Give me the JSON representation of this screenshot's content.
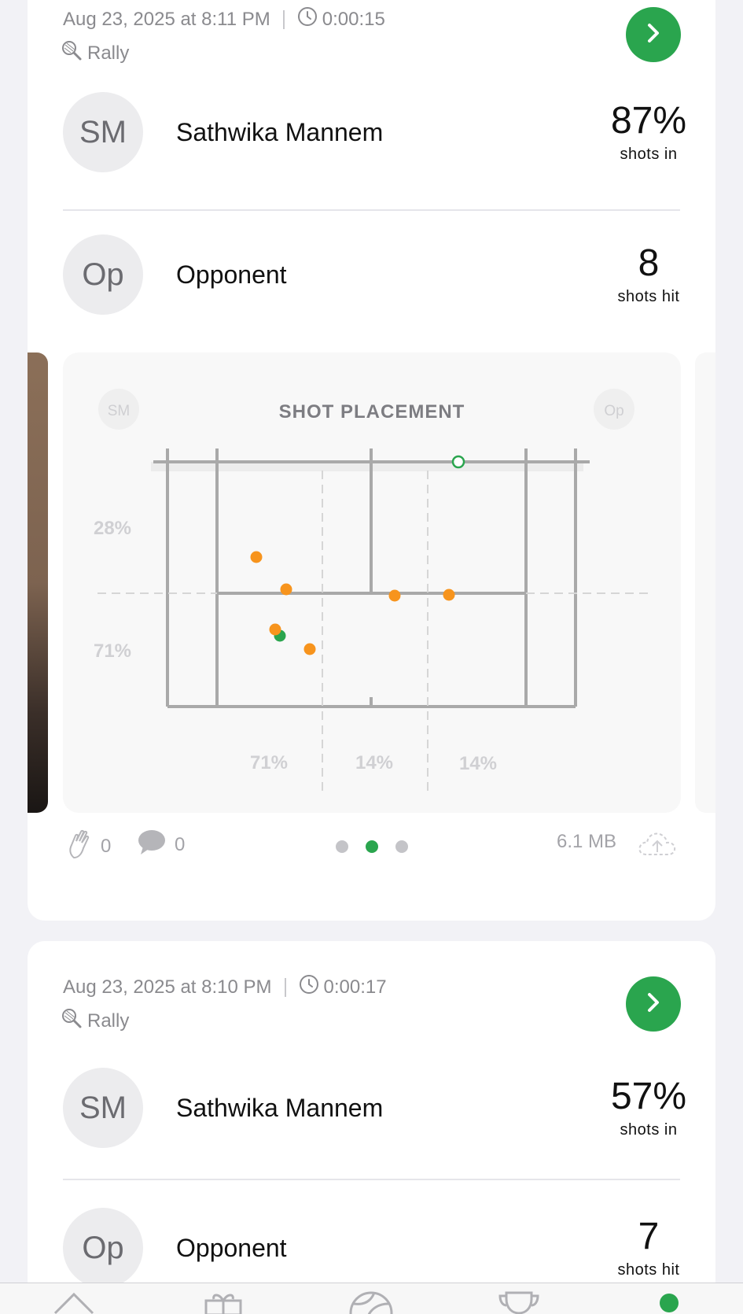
{
  "sessions": [
    {
      "date": "Aug 23, 2025 at 8:11 PM",
      "duration": "0:00:15",
      "type": "Rally",
      "player": {
        "initials": "SM",
        "name": "Sathwika Mannem",
        "stat": "87%",
        "stat_label": "shots in"
      },
      "opponent": {
        "initials": "Op",
        "name": "Opponent",
        "stat": "8",
        "stat_label": "shots hit"
      },
      "placement": {
        "title": "SHOT PLACEMENT",
        "left_badge": "SM",
        "right_badge": "Op",
        "depth_pct": [
          "28%",
          "71%"
        ],
        "lane_pct": [
          "71%",
          "14%",
          "14%"
        ]
      },
      "footer": {
        "claps": "0",
        "comments": "0",
        "size": "6.1 MB"
      }
    },
    {
      "date": "Aug 23, 2025 at 8:10 PM",
      "duration": "0:00:17",
      "type": "Rally",
      "player": {
        "initials": "SM",
        "name": "Sathwika Mannem",
        "stat": "57%",
        "stat_label": "shots in"
      },
      "opponent": {
        "initials": "Op",
        "name": "Opponent",
        "stat": "7",
        "stat_label": "shots hit"
      }
    }
  ],
  "colors": {
    "accent": "#2aa54e",
    "shot": "#f7941d",
    "court_line": "#a9a9a9"
  },
  "icons": {
    "go": "chevron-right-icon",
    "clock": "clock-icon",
    "racket": "racket-icon",
    "clap": "clap-icon",
    "comment": "comment-icon",
    "upload": "cloud-upload-icon"
  },
  "pager": {
    "total": 3,
    "active": 2
  },
  "tabs": [
    "home-icon",
    "gift-icon",
    "ball-icon",
    "trophy-icon",
    "profile-dot-icon"
  ]
}
